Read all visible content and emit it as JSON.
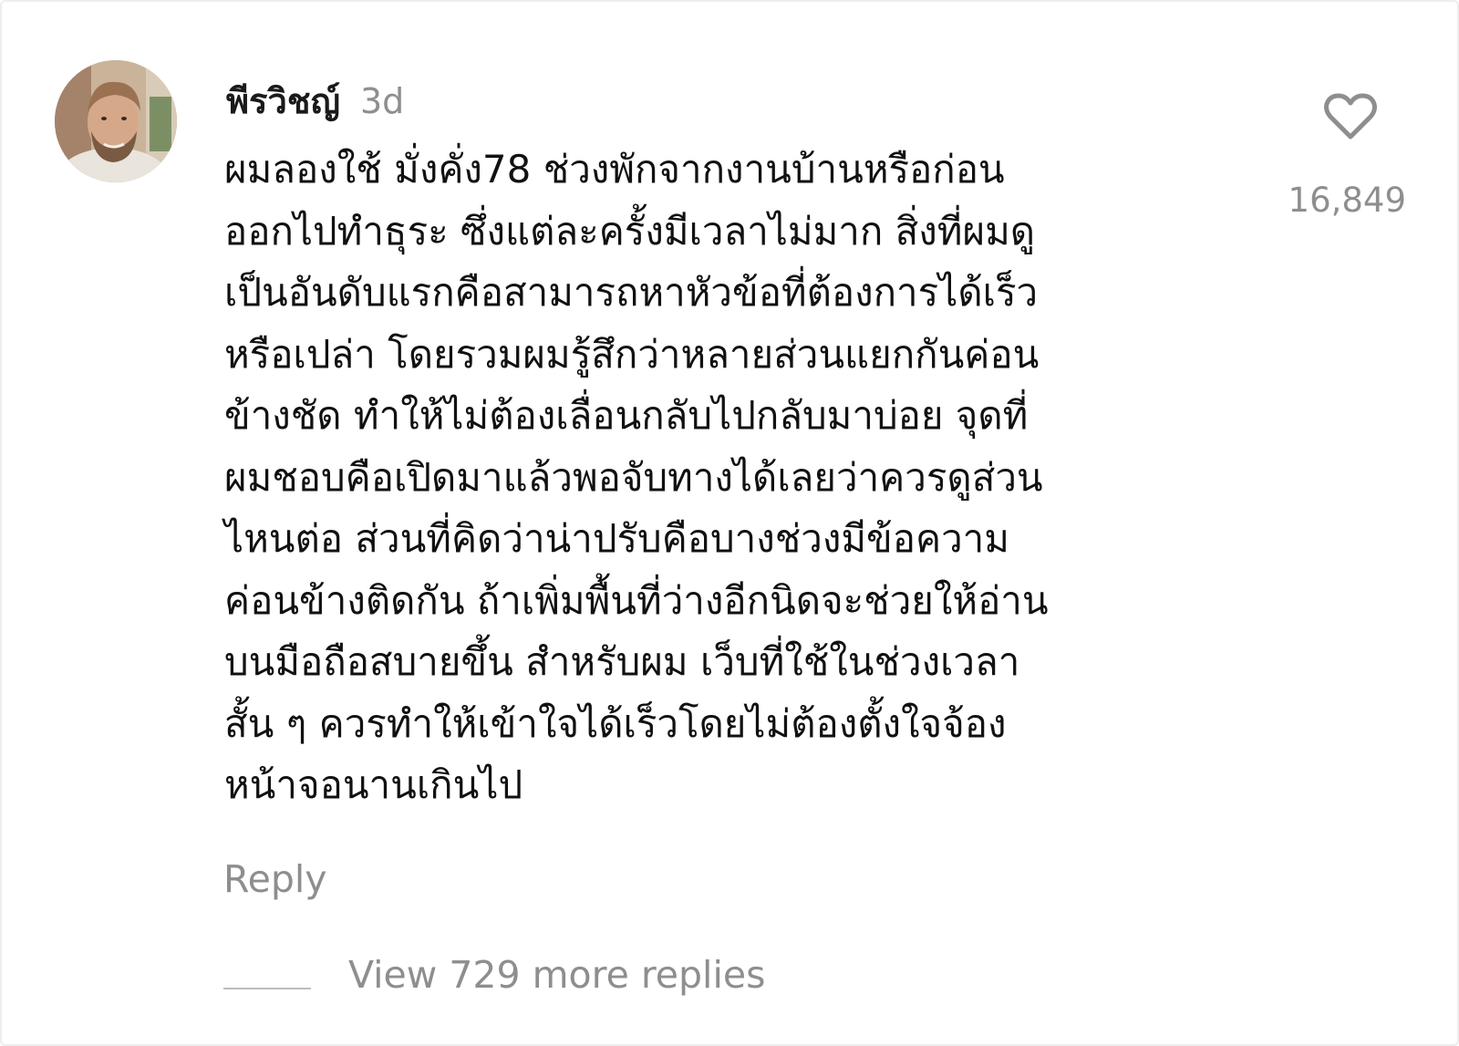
{
  "comment": {
    "author": "พีรวิชญ์",
    "age": "3d",
    "lines": [
      "ผมลองใช้ มั่งคั่ง78 ช่วงพักจากงานบ้านหรือก่อน",
      "ออกไปทำธุระ ซึ่งแต่ละครั้งมีเวลาไม่มาก สิ่งที่ผมดู",
      "เป็นอันดับแรกคือสามารถหาหัวข้อที่ต้องการได้เร็ว",
      "หรือเปล่า โดยรวมผมรู้สึกว่าหลายส่วนแยกกันค่อน",
      "ข้างชัด ทำให้ไม่ต้องเลื่อนกลับไปกลับมาบ่อย จุดที่",
      "ผมชอบคือเปิดมาแล้วพอจับทางได้เลยว่าควรดูส่วน",
      "ไหนต่อ ส่วนที่คิดว่าน่าปรับคือบางช่วงมีข้อความ",
      "ค่อนข้างติดกัน ถ้าเพิ่มพื้นที่ว่างอีกนิดจะช่วยให้อ่าน",
      "บนมือถือสบายขึ้น สำหรับผม เว็บที่ใช้ในช่วงเวลา",
      "สั้น ๆ ควรทำให้เข้าใจได้เร็วโดยไม่ต้องตั้งใจจ้อง",
      "หน้าจอนานเกินไป"
    ],
    "like_icon": "heart-outline-icon",
    "like_count": "16,849",
    "reply_label": "Reply",
    "view_replies_label": "View 729 more replies"
  },
  "colors": {
    "text": "#111111",
    "muted": "#8e8e8e",
    "divider": "#bdbdbd",
    "background": "#ffffff"
  }
}
